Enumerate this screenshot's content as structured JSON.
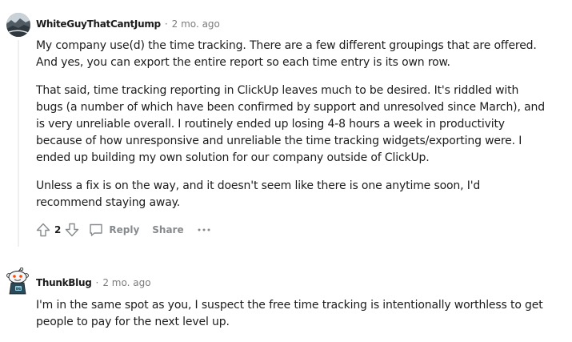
{
  "comments": [
    {
      "username": "WhiteGuyThatCantJump",
      "separator": "·",
      "time": "2 mo. ago",
      "paragraphs": [
        "My company use(d) the time tracking. There are a few different groupings that are offered. And yes, you can export the entire report so each time entry is its own row.",
        "That said, time tracking reporting in ClickUp leaves much to be desired. It's riddled with bugs (a number of which have been confirmed by support and unresolved since March), and is very unreliable overall. I routinely ended up losing 4-8 hours a week in productivity because of how unresponsive and unreliable the time tracking widgets/exporting were. I ended up building my own solution for our company outside of ClickUp.",
        "Unless a fix is on the way, and it doesn't seem like there is one anytime soon, I'd recommend staying away."
      ],
      "score": "2",
      "reply_label": "Reply",
      "share_label": "Share",
      "more_label": "···"
    },
    {
      "username": "ThunkBlug",
      "separator": "·",
      "time": "2 mo. ago",
      "paragraphs": [
        "I'm in the same spot as you, I suspect the free time tracking is intentionally worthless to get people to pay for the next level up."
      ]
    }
  ],
  "icons": {
    "upvote": "arrow-up-outline-icon",
    "downvote": "arrow-down-outline-icon",
    "reply": "speech-bubble-icon",
    "more": "ellipsis-icon"
  },
  "colors": {
    "text": "#1c1c1c",
    "meta": "#7c7c7c",
    "action": "#878a8c",
    "thread_line": "#edeff1"
  }
}
